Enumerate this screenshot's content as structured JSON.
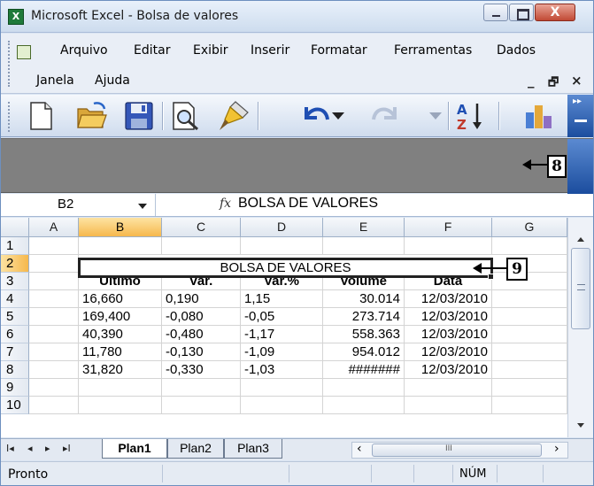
{
  "window": {
    "title": "Microsoft Excel - Bolsa de valores",
    "app_icon_letter": "X",
    "close_glyph": "X"
  },
  "menu": {
    "arquivo": "Arquivo",
    "editar": "Editar",
    "exibir": "Exibir",
    "inserir": "Inserir",
    "formatar": "Formatar",
    "ferramentas": "Ferramentas",
    "dados": "Dados",
    "janela": "Janela",
    "ajuda": "Ajuda",
    "mdi_min": "_",
    "mdi_restore": "🗗",
    "mdi_close": "×"
  },
  "toolbar": {
    "icons": [
      "new-document-icon",
      "open-folder-icon",
      "save-icon",
      "print-preview-icon",
      "format-painter-icon",
      "undo-icon",
      "redo-icon",
      "sort-ascending-icon",
      "chart-wizard-icon"
    ]
  },
  "callouts": {
    "c8": "8",
    "c9": "9"
  },
  "formula_bar": {
    "name_box": "B2",
    "fx_label": "fx",
    "formula": "BOLSA DE VALORES"
  },
  "sheet": {
    "columns": [
      "A",
      "B",
      "C",
      "D",
      "E",
      "F",
      "G"
    ],
    "selected_column": "B",
    "rows": [
      "1",
      "2",
      "3",
      "4",
      "5",
      "6",
      "7",
      "8",
      "9",
      "10"
    ],
    "selected_row": "2",
    "title": "BOLSA DE VALORES",
    "headers": {
      "ultimo": "Último",
      "var": "Var.",
      "var_pct": "Var.%",
      "volume": "Volume",
      "data": "Data"
    },
    "records": [
      {
        "ultimo": "16,660",
        "var": "0,190",
        "var_pct": "1,15",
        "volume": "30.014",
        "data": "12/03/2010"
      },
      {
        "ultimo": "169,400",
        "var": "-0,080",
        "var_pct": "-0,05",
        "volume": "273.714",
        "data": "12/03/2010"
      },
      {
        "ultimo": "40,390",
        "var": "-0,480",
        "var_pct": "-1,17",
        "volume": "558.363",
        "data": "12/03/2010"
      },
      {
        "ultimo": "11,780",
        "var": "-0,130",
        "var_pct": "-1,09",
        "volume": "954.012",
        "data": "12/03/2010"
      },
      {
        "ultimo": "31,820",
        "var": "-0,330",
        "var_pct": "-1,03",
        "volume": "#######",
        "data": "12/03/2010"
      }
    ]
  },
  "tabs": {
    "nav_first": "I◂",
    "nav_prev": "◂",
    "nav_next": "▸",
    "nav_last": "▸I",
    "sheets": [
      "Plan1",
      "Plan2",
      "Plan3"
    ],
    "active": "Plan1",
    "scroll_left": "‹",
    "scroll_right": "›",
    "scroll_grip": "III"
  },
  "status": {
    "text": "Pronto",
    "num": "NÚM"
  },
  "colors": {
    "selected_header": "#f6b84d",
    "title_bar": "#cddcee",
    "gray_band": "#808080",
    "accent_blue": "#1b4d9e"
  }
}
